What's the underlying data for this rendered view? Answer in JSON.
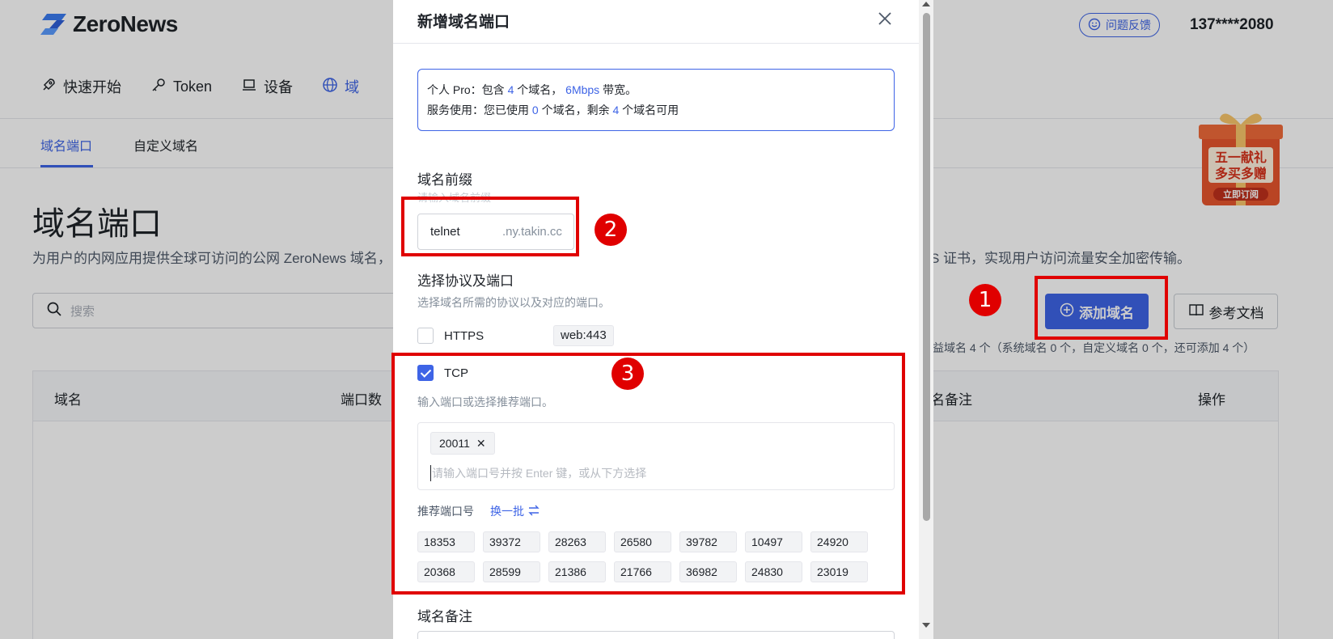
{
  "app": {
    "brand": "ZeroNews",
    "feedback_label": "问题反馈",
    "user": "137****2080"
  },
  "nav": [
    {
      "label": "快速开始",
      "icon": "rocket-icon"
    },
    {
      "label": "Token",
      "icon": "key-icon"
    },
    {
      "label": "设备",
      "icon": "laptop-icon"
    },
    {
      "label": "域",
      "icon": "globe-icon"
    }
  ],
  "subnav": {
    "tab1": "域名端口",
    "tab2": "自定义域名"
  },
  "page": {
    "title": "域名端口",
    "desc_left": "为用户的内网应用提供全球可访问的公网 ZeroNews 域名，",
    "desc_right": "S 证书，实现用户访问流量安全加密传输。",
    "search_placeholder": "搜索",
    "add_button": "添加域名",
    "doc_button": "参考文档",
    "quota_text": "益域名 4 个（系统域名 0 个，自定义域名 0 个，还可添加 4 个）",
    "table_headers": {
      "domain": "域名",
      "ports": "端口数",
      "remark": "名备注",
      "actions": "操作"
    }
  },
  "promo": {
    "line1": "五一献礼",
    "line2": "多买多赠",
    "cta": "立即订阅"
  },
  "modal": {
    "title": "新增域名端口",
    "info": {
      "line1_prefix": "个人 Pro：包含",
      "line1_domains": "4",
      "line1_mid": "个域名，",
      "line1_bandwidth": "6Mbps",
      "line1_suffix": "带宽。",
      "line2_prefix": "服务使用：您已使用",
      "line2_used": "0",
      "line2_mid": "个域名，剩余",
      "line2_left": "4",
      "line2_suffix": "个域名可用"
    },
    "prefix_label": "域名前缀",
    "prefix_hint": "请输入域名前缀",
    "prefix_value": "telnet",
    "prefix_suffix": ".ny.takin.cc",
    "protocol_label": "选择协议及端口",
    "protocol_hint": "选择域名所需的协议以及对应的端口。",
    "https_label": "HTTPS",
    "https_port": "web:443",
    "tcp_label": "TCP",
    "tcp_hint": "输入端口或选择推荐端口。",
    "selected_port": "20011",
    "port_placeholder": "请输入端口号并按 Enter 键，或从下方选择",
    "recommend_label": "推荐端口号",
    "refresh_label": "换一批",
    "recommended_ports": [
      "18353",
      "39372",
      "28263",
      "26580",
      "39782",
      "10497",
      "24920",
      "20368",
      "28599",
      "21386",
      "21766",
      "36982",
      "24830",
      "23019"
    ],
    "remark_label": "域名备注"
  },
  "annotations": [
    "1",
    "2",
    "3"
  ],
  "colors": {
    "accent": "#3e64e6",
    "annotation": "#e00000"
  }
}
